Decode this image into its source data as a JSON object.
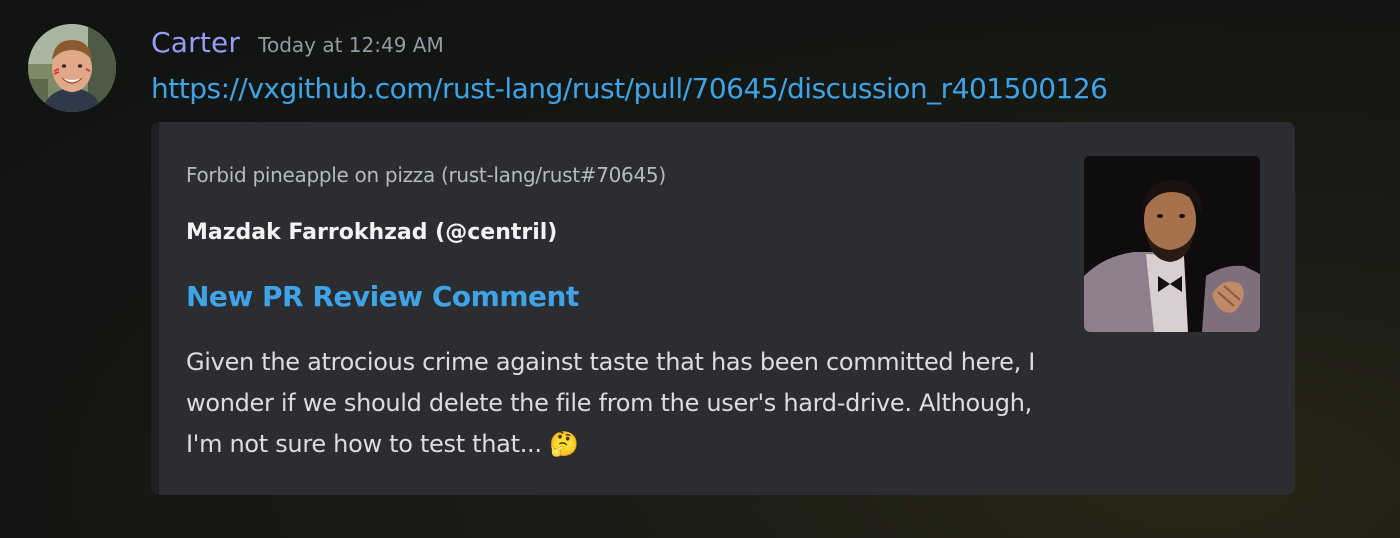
{
  "message": {
    "author": "Carter",
    "timestamp": "Today at 12:49 AM",
    "link": "https://vxgithub.com/rust-lang/rust/pull/70645/discussion_r401500126"
  },
  "embed": {
    "provider": "Forbid pineapple on pizza (rust-lang/rust#70645)",
    "author": "Mazdak Farrokhzad (@centril)",
    "title": "New PR Review Comment",
    "description": "Given the atrocious crime against taste that has been committed here, I wonder if we should delete the file from the user's hard-drive. Although, I'm not sure how to test that... 🤔"
  },
  "colors": {
    "username": "#949cf7",
    "link": "#3fa3e8",
    "embed_background": "#2b2d31"
  }
}
